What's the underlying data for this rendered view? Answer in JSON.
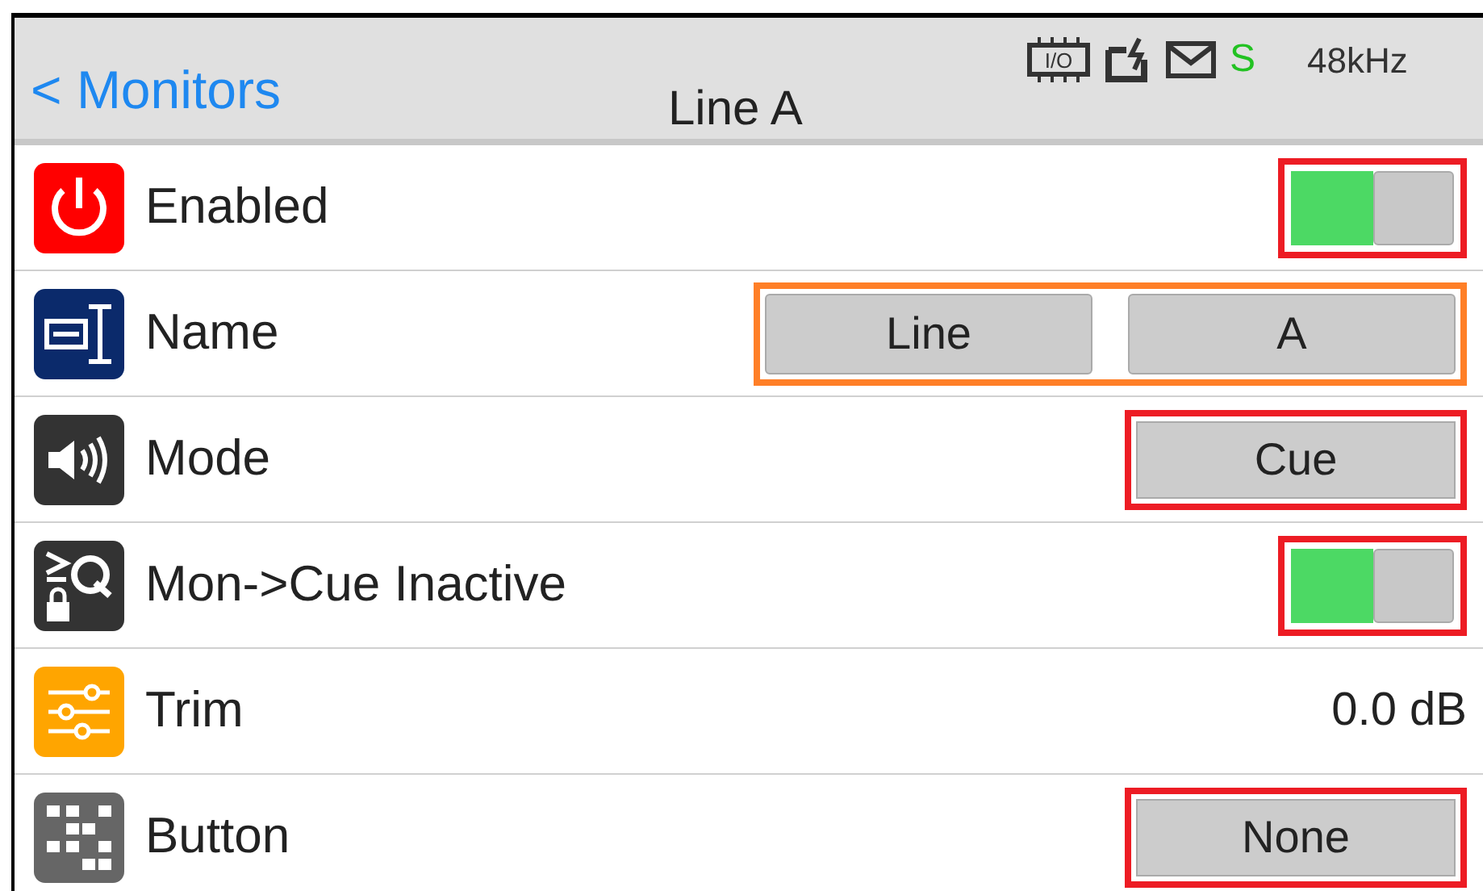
{
  "header": {
    "back": "< Monitors",
    "title": "Line A",
    "status": {
      "io": "I/O",
      "sync": "S",
      "rate": "48kHz"
    }
  },
  "rows": [
    {
      "label": "Enabled",
      "kind": "toggle",
      "on": true,
      "color": "#ed1c24"
    },
    {
      "label": "Name",
      "kind": "pair",
      "values": [
        "Line",
        "A"
      ],
      "color": "#ff7f27"
    },
    {
      "label": "Mode",
      "kind": "button",
      "value": "Cue",
      "color": "#ed1c24"
    },
    {
      "label": "Mon->Cue Inactive",
      "kind": "toggle",
      "on": true,
      "color": "#ed1c24"
    },
    {
      "label": "Trim",
      "kind": "value",
      "value": "0.0 dB"
    },
    {
      "label": "Button",
      "kind": "button",
      "value": "None",
      "color": "#ed1c24"
    }
  ]
}
